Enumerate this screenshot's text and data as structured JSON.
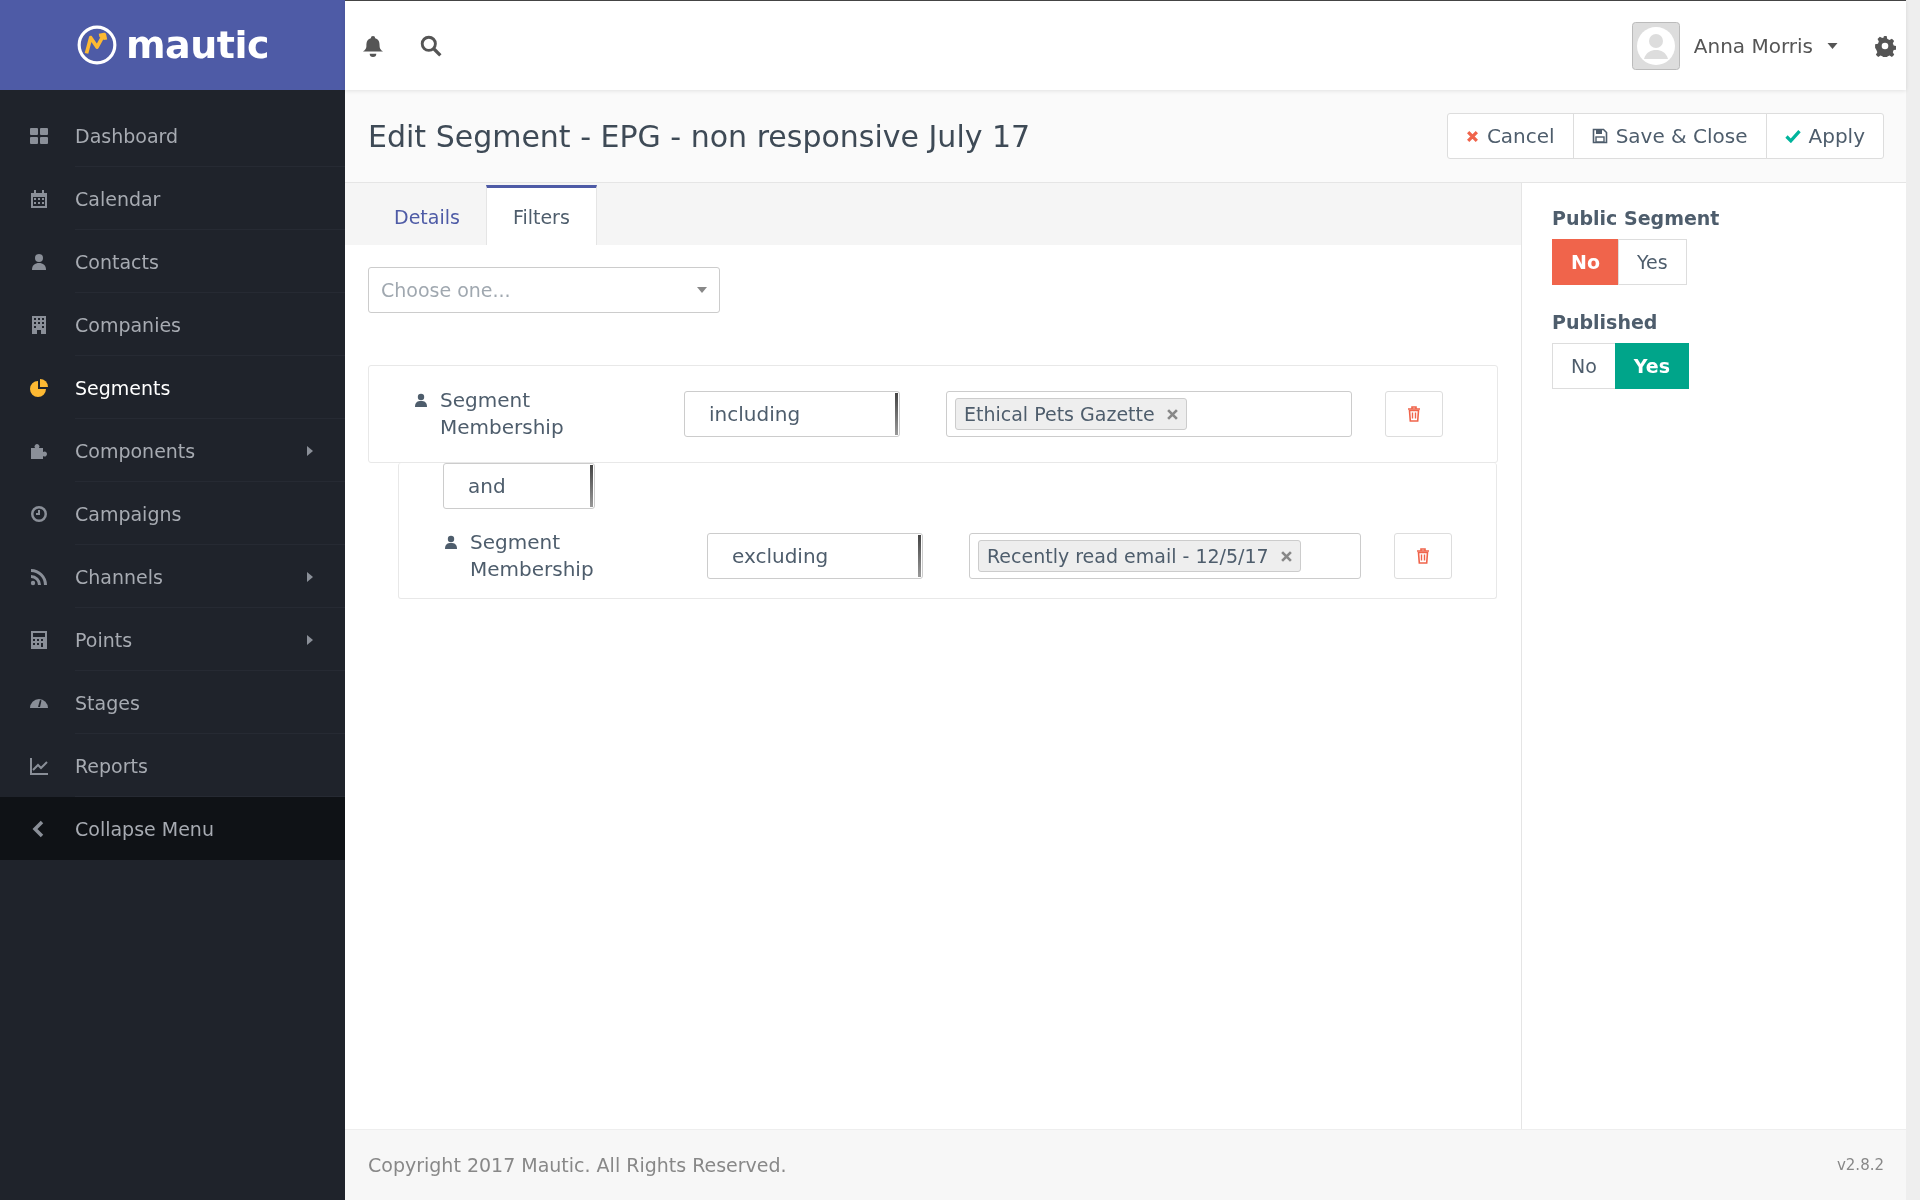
{
  "brand": {
    "name": "mautic"
  },
  "sidebar": {
    "items": [
      {
        "kind": "dashboard",
        "label": "Dashboard",
        "selected": false,
        "has_submenu": false
      },
      {
        "kind": "calendar",
        "label": "Calendar",
        "selected": false,
        "has_submenu": false
      },
      {
        "kind": "contacts",
        "label": "Contacts",
        "selected": false,
        "has_submenu": false
      },
      {
        "kind": "companies",
        "label": "Companies",
        "selected": false,
        "has_submenu": false
      },
      {
        "kind": "segments",
        "label": "Segments",
        "selected": true,
        "has_submenu": false
      },
      {
        "kind": "components",
        "label": "Components",
        "selected": false,
        "has_submenu": true
      },
      {
        "kind": "campaigns",
        "label": "Campaigns",
        "selected": false,
        "has_submenu": false
      },
      {
        "kind": "channels",
        "label": "Channels",
        "selected": false,
        "has_submenu": true
      },
      {
        "kind": "points",
        "label": "Points",
        "selected": false,
        "has_submenu": true
      },
      {
        "kind": "stages",
        "label": "Stages",
        "selected": false,
        "has_submenu": false
      },
      {
        "kind": "reports",
        "label": "Reports",
        "selected": false,
        "has_submenu": false
      }
    ],
    "collapse": "Collapse Menu"
  },
  "topbar": {
    "user_name": "Anna Morris"
  },
  "page": {
    "title": "Edit Segment - EPG - non responsive July 17",
    "buttons": [
      {
        "kind": "cancel",
        "label": "Cancel"
      },
      {
        "kind": "save",
        "label": "Save & Close"
      },
      {
        "kind": "apply",
        "label": "Apply"
      }
    ]
  },
  "tabs": [
    {
      "label": "Details",
      "selected": false
    },
    {
      "label": "Filters",
      "selected": true
    }
  ],
  "filter_chooser": {
    "placeholder": "Choose one..."
  },
  "filters": [
    {
      "label": "Segment Membership",
      "operator": "including",
      "values": [
        "Ethical Pets Gazette"
      ]
    },
    {
      "glue": "and",
      "label": "Segment Membership",
      "operator": "excluding",
      "values": [
        "Recently read email - 12/5/17"
      ]
    }
  ],
  "settings": [
    {
      "label": "Public Segment",
      "options": [
        {
          "kind": "no",
          "label": "No",
          "selected": true
        },
        {
          "kind": "yes",
          "label": "Yes",
          "selected": false
        }
      ]
    },
    {
      "label": "Published",
      "options": [
        {
          "kind": "no",
          "label": "No",
          "selected": false
        },
        {
          "kind": "yes",
          "label": "Yes",
          "selected": true
        }
      ]
    }
  ],
  "footer": {
    "copyright": "Copyright 2017 Mautic. All Rights Reserved.",
    "version": "v2.8.2"
  }
}
